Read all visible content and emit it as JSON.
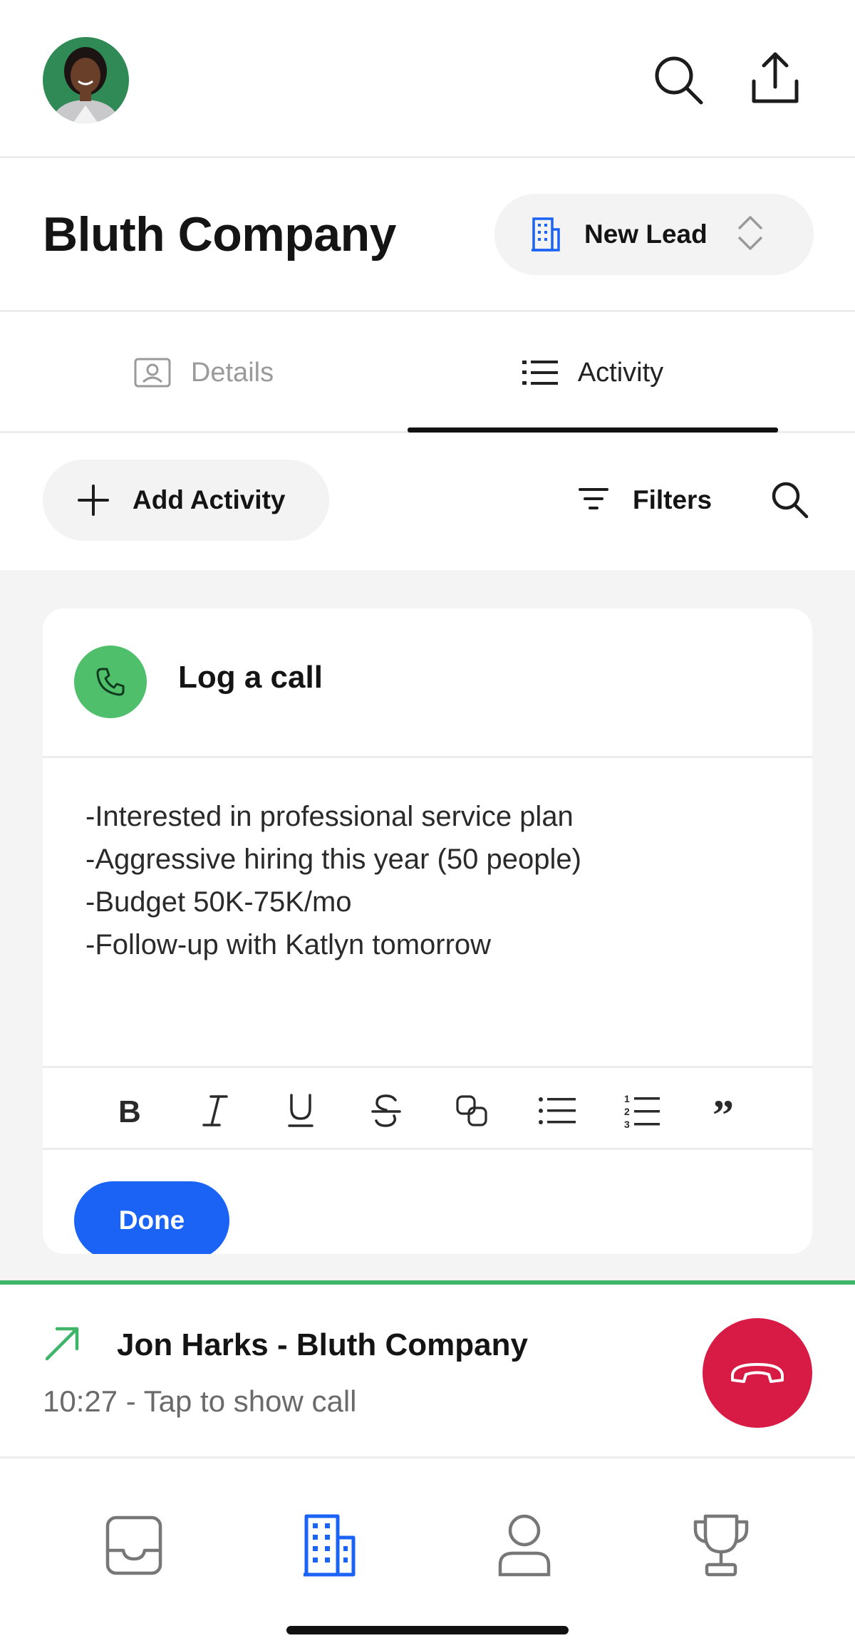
{
  "header": {
    "company_name": "Bluth Company",
    "status_label": "New Lead"
  },
  "tabs": [
    {
      "label": "Details",
      "icon": "contact-card-icon",
      "active": false
    },
    {
      "label": "Activity",
      "icon": "list-icon",
      "active": true
    }
  ],
  "toolbar": {
    "add_activity_label": "Add Activity",
    "filters_label": "Filters"
  },
  "activity_card": {
    "title": "Log a call",
    "icon": "phone-icon",
    "notes": [
      "-Interested in professional service plan",
      "-Aggressive hiring this year (50 people)",
      "-Budget 50K-75K/mo",
      "-Follow-up with Katlyn tomorrow"
    ],
    "formatting_tools": [
      "bold",
      "italic",
      "underline",
      "strikethrough",
      "link",
      "bullet-list",
      "numbered-list",
      "quote"
    ],
    "done_label": "Done"
  },
  "call_bar": {
    "title": "Jon Harks - Bluth Company",
    "subtitle": "10:27 - Tap to show call"
  },
  "bottom_nav": [
    {
      "icon": "inbox-icon",
      "active": false
    },
    {
      "icon": "building-icon",
      "active": true
    },
    {
      "icon": "person-icon",
      "active": false
    },
    {
      "icon": "trophy-icon",
      "active": false
    }
  ],
  "colors": {
    "accent_blue": "#1b63f5",
    "call_green": "#4fbf6b",
    "call_bar_green": "#3fb56a",
    "hangup_red": "#d81b45",
    "feed_background": "#f4f4f4"
  }
}
